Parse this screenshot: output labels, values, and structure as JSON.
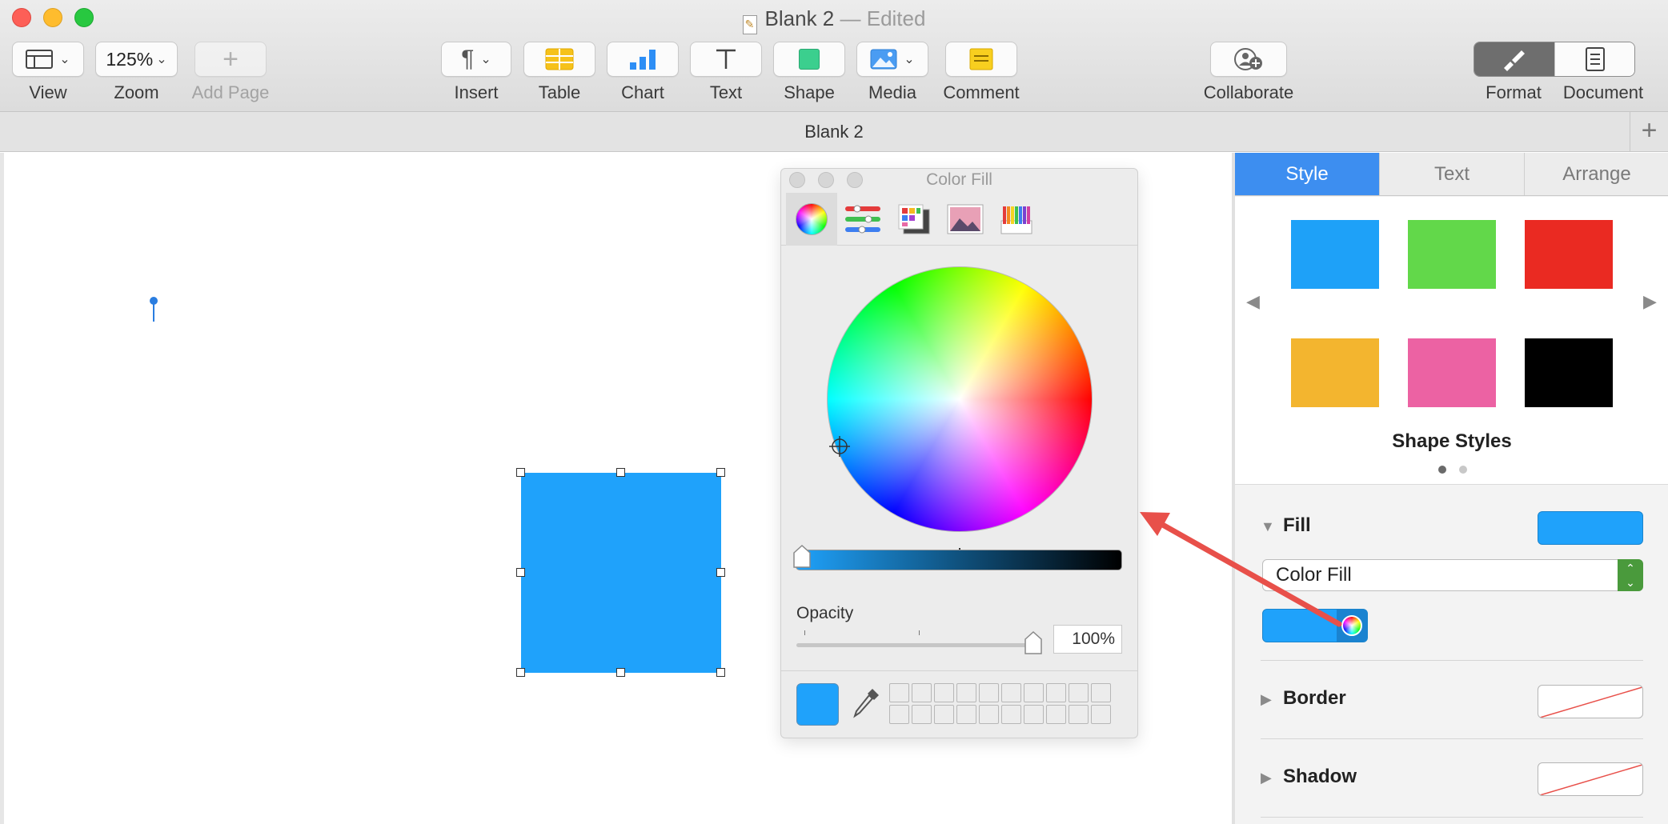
{
  "window": {
    "title": "Blank 2",
    "status": "— Edited"
  },
  "toolbar": {
    "view_label": "View",
    "zoom_value": "125%",
    "zoom_label": "Zoom",
    "add_page_label": "Add Page",
    "insert_label": "Insert",
    "table_label": "Table",
    "chart_label": "Chart",
    "text_label": "Text",
    "shape_label": "Shape",
    "media_label": "Media",
    "comment_label": "Comment",
    "collaborate_label": "Collaborate",
    "format_label": "Format",
    "document_label": "Document"
  },
  "tabbar": {
    "title": "Blank 2"
  },
  "color_panel": {
    "title": "Color Fill",
    "modes": [
      "color-wheel",
      "color-sliders",
      "color-palettes",
      "image-palettes",
      "pencils"
    ],
    "active_mode": "color-wheel",
    "brightness": 0.0,
    "opacity_label": "Opacity",
    "opacity_value": "100%",
    "current_color": "#1fa2fb"
  },
  "sidebar": {
    "tabs": [
      "Style",
      "Text",
      "Arrange"
    ],
    "active_tab": "Style",
    "shape_styles": {
      "title": "Shape Styles",
      "swatches": [
        "#1ea1f8",
        "#62d84a",
        "#ea2a22",
        "#f3b52f",
        "#ec62a3",
        "#000000"
      ],
      "page": 1,
      "pages": 2
    },
    "fill": {
      "label": "Fill",
      "color": "#1fa2fb",
      "type_value": "Color Fill"
    },
    "border": {
      "label": "Border"
    },
    "shadow": {
      "label": "Shadow"
    }
  },
  "colors": {
    "accent": "#3d8ef0",
    "shape_fill": "#1fa2fb",
    "annotation_arrow": "#e8504a"
  }
}
